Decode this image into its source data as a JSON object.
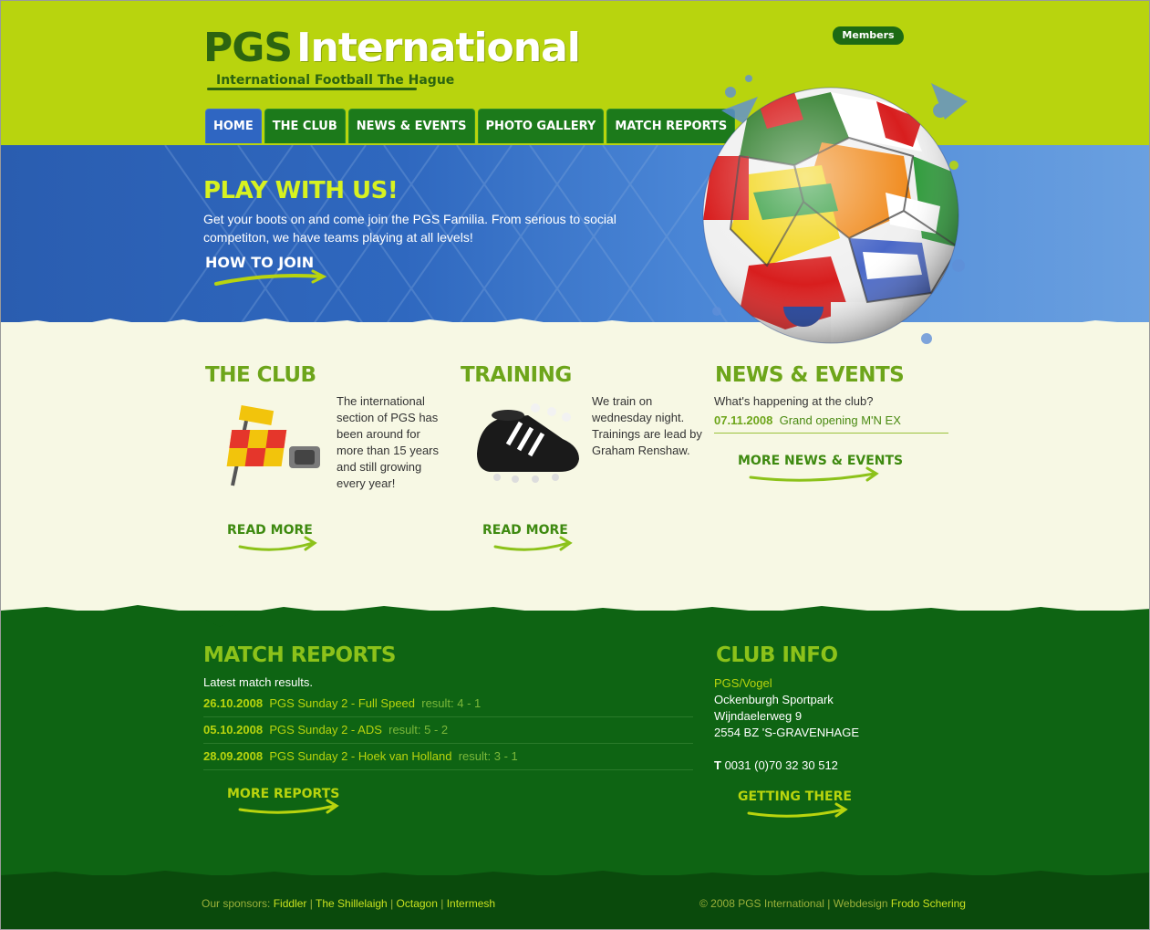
{
  "header": {
    "logo_pgs": "PGS",
    "logo_name": "International",
    "tagline": "International Football The Hague",
    "members_label": "Members"
  },
  "nav": {
    "items": [
      {
        "label": "HOME",
        "active": true
      },
      {
        "label": "THE CLUB",
        "active": false
      },
      {
        "label": "NEWS & EVENTS",
        "active": false
      },
      {
        "label": "PHOTO GALLERY",
        "active": false
      },
      {
        "label": "MATCH REPORTS",
        "active": false
      }
    ]
  },
  "hero": {
    "title": "PLAY WITH US!",
    "text": "Get your boots on and come join the PGS Familia. From serious to social competiton, we have teams playing at all levels!",
    "link": "HOW TO JOIN"
  },
  "club": {
    "heading": "THE CLUB",
    "text": "The international section of PGS has been around for more than 15 years and still growing every year!",
    "link": "READ MORE"
  },
  "training": {
    "heading": "TRAINING",
    "text": "We train on wednesday night. Trainings are lead by Graham Renshaw.",
    "link": "READ MORE"
  },
  "news": {
    "heading": "NEWS & EVENTS",
    "intro": "What's happening at the club?",
    "items": [
      {
        "date": "07.11.2008",
        "title": "Grand opening M'N EX"
      }
    ],
    "link": "MORE NEWS & EVENTS"
  },
  "match_reports": {
    "heading": "MATCH REPORTS",
    "intro": "Latest match results.",
    "rows": [
      {
        "date": "26.10.2008",
        "match": "PGS Sunday 2 - Full Speed",
        "result": "result: 4 - 1"
      },
      {
        "date": "05.10.2008",
        "match": "PGS Sunday 2 - ADS",
        "result": "result: 5 - 2"
      },
      {
        "date": "28.09.2008",
        "match": "PGS Sunday 2 - Hoek van Holland",
        "result": "result: 3 - 1"
      }
    ],
    "link": "MORE REPORTS"
  },
  "club_info": {
    "heading": "CLUB INFO",
    "name": "PGS/Vogel",
    "line1": "Ockenburgh Sportpark",
    "line2": "Wijndaelerweg 9",
    "line3": "2554 BZ 'S-GRAVENHAGE",
    "phone_label": "T",
    "phone": "0031 (0)70 32 30 512",
    "link": "GETTING THERE"
  },
  "footer": {
    "sponsors_label": "Our sponsors:",
    "sponsors": [
      "Fiddler",
      "The Shillelaigh",
      "Octagon",
      "Intermesh"
    ],
    "copyright": "© 2008 PGS International",
    "webdesign_label": "Webdesign",
    "webdesigner": "Frodo Schering"
  },
  "colors": {
    "lime": "#b8d40e",
    "dark_green": "#0e6413",
    "hero_blue": "#2f68bf",
    "cream": "#f7f8e4",
    "heading_green": "#6da51a"
  }
}
